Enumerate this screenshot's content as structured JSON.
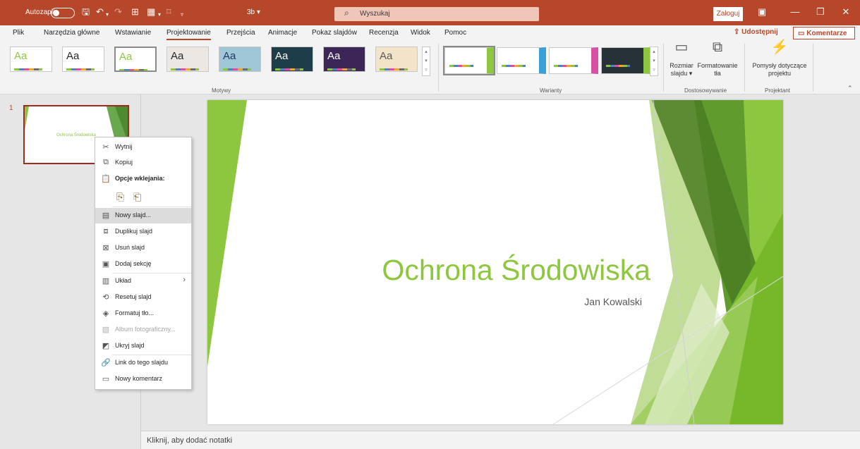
{
  "titlebar": {
    "autosave_label": "Autozapis",
    "filename": "3b",
    "search_placeholder": "Wyszukaj",
    "signin_label": "Zaloguj się"
  },
  "tabs": [
    "Plik",
    "Narzędzia główne",
    "Wstawianie",
    "Projektowanie",
    "Przejścia",
    "Animacje",
    "Pokaz slajdów",
    "Recenzja",
    "Widok",
    "Pomoc"
  ],
  "active_tab": "Projektowanie",
  "share_label": "Udostępnij",
  "comments_label": "Komentarze",
  "ribbon": {
    "themes": [
      {
        "aa": "Aa",
        "fg": "#8dc63f",
        "bg": "#ffffff"
      },
      {
        "aa": "Aa",
        "fg": "#262626",
        "bg": "#ffffff"
      },
      {
        "aa": "Aa",
        "fg": "#8dc63f",
        "bg": "#ffffff"
      },
      {
        "aa": "Aa",
        "fg": "#262626",
        "bg": "#ece7e2"
      },
      {
        "aa": "Aa",
        "fg": "#1f3864",
        "bg": "#9fc7d8"
      },
      {
        "aa": "Aa",
        "fg": "#ffffff",
        "bg": "#1d3d49"
      },
      {
        "aa": "Aa",
        "fg": "#ffffff",
        "bg": "#3b2657"
      },
      {
        "aa": "Aa",
        "fg": "#595959",
        "bg": "#f2e3c9"
      }
    ],
    "group_themes": "Motywy",
    "variants": [
      {
        "bg": "#ffffff",
        "accent": "#8dc63f"
      },
      {
        "bg": "#ffffff",
        "accent": "#3aa0d8"
      },
      {
        "bg": "#ffffff",
        "accent": "#d94fa3"
      },
      {
        "bg": "#263238",
        "accent": "#8dc63f"
      }
    ],
    "group_variants": "Warianty",
    "slide_size_label": "Rozmiar slajdu",
    "format_bg_label": "Formatowanie tła",
    "group_customize": "Dostosowywanie",
    "design_ideas_label": "Pomysły dotyczące projektu",
    "group_designer": "Projektant"
  },
  "thumbnail": {
    "number": "1",
    "title": "Ochrona Środowiska"
  },
  "slide": {
    "title": "Ochrona Środowiska",
    "subtitle": "Jan Kowalski"
  },
  "notes_placeholder": "Kliknij, aby dodać notatki",
  "context_menu": {
    "cut": "Wytnij",
    "copy": "Kopiuj",
    "paste_options": "Opcje wklejania:",
    "new_slide": "Nowy slajd...",
    "duplicate_slide": "Duplikuj slajd",
    "delete_slide": "Usuń slajd",
    "add_section": "Dodaj sekcję",
    "layout": "Układ",
    "reset_slide": "Resetuj slajd",
    "format_background": "Formatuj tło...",
    "photo_album": "Album fotograficzny...",
    "hide_slide": "Ukryj slajd",
    "link_to_slide": "Link do tego slajdu",
    "new_comment": "Nowy komentarz"
  },
  "colors": {
    "accent": "#b7472a",
    "slide_green": "#8dc63f"
  }
}
